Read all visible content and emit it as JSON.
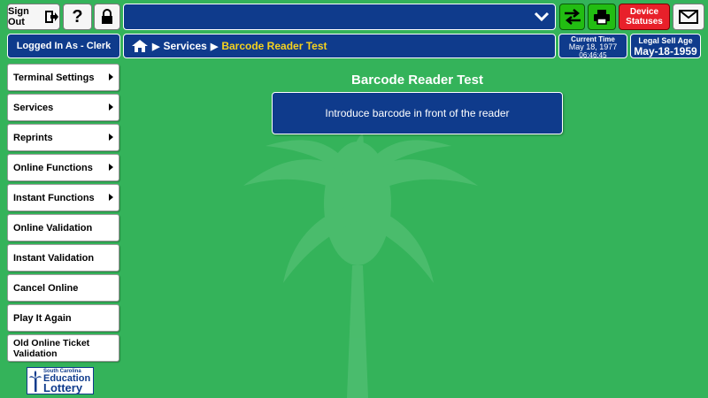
{
  "toolbar": {
    "sign_out_label": "Sign Out",
    "help_label": "?",
    "device_statuses_label": "Device Statuses"
  },
  "status": {
    "logged_in_label": "Logged In As - Clerk",
    "current_time_label": "Current Time",
    "current_date": "May 18, 1977",
    "current_clock": "06:46:45",
    "legal_age_label": "Legal Sell Age",
    "legal_age_date": "May-18-1959"
  },
  "breadcrumb": {
    "items": [
      "Services",
      "Barcode Reader Test"
    ]
  },
  "sidebar": {
    "items": [
      {
        "label": "Terminal Settings",
        "has_submenu": true
      },
      {
        "label": "Services",
        "has_submenu": true
      },
      {
        "label": "Reprints",
        "has_submenu": true
      },
      {
        "label": "Online Functions",
        "has_submenu": true
      },
      {
        "label": "Instant Functions",
        "has_submenu": true
      },
      {
        "label": "Online Validation",
        "has_submenu": false
      },
      {
        "label": "Instant Validation",
        "has_submenu": false
      },
      {
        "label": "Cancel Online",
        "has_submenu": false
      },
      {
        "label": "Play It Again",
        "has_submenu": false
      },
      {
        "label": "Old Online Ticket Validation",
        "has_submenu": false
      }
    ]
  },
  "main": {
    "title": "Barcode Reader Test",
    "instruction": "Introduce barcode in front of the reader"
  },
  "logo": {
    "line1": "South Carolina",
    "line2": "Education",
    "line3": "Lottery"
  },
  "colors": {
    "background": "#34b35a",
    "navy": "#0f3b8c",
    "accent_green": "#22bd12",
    "alert_red": "#e8202a",
    "breadcrumb_current": "#f5d21e"
  }
}
